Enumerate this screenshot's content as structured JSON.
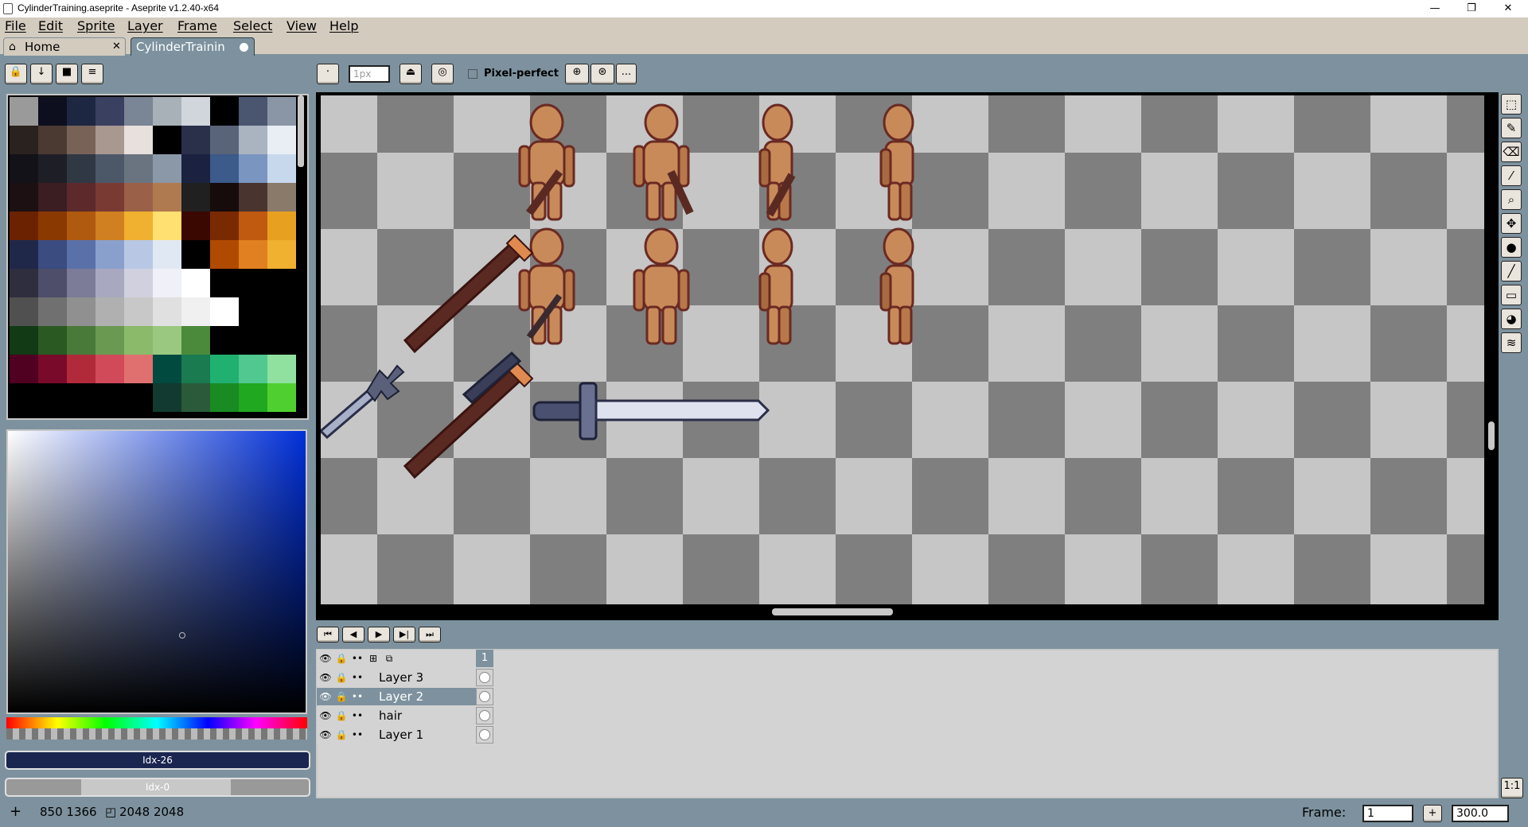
{
  "window": {
    "title": "CylinderTraining.aseprite - Aseprite v1.2.40-x64",
    "min_glyph": "—",
    "restore_glyph": "❐",
    "close_glyph": "✕"
  },
  "menubar": [
    "File",
    "Edit",
    "Sprite",
    "Layer",
    "Frame",
    "Select",
    "View",
    "Help"
  ],
  "tabs": [
    {
      "label": "Home",
      "icon": "home-icon",
      "close_glyph": "✕"
    },
    {
      "label": "CylinderTrainin",
      "active": true
    }
  ],
  "context_bar": {
    "brush_size_placeholder": "1px",
    "pixel_perfect_label": "Pixel-perfect",
    "more_label": "..."
  },
  "palette": {
    "swatches": [
      "#9a9a9a",
      "#0d0f1f",
      "#1d2742",
      "#3a4060",
      "#7a8595",
      "#a8b0b8",
      "#d0d6dc",
      "#000000",
      "#4a5570",
      "#8a96a6",
      "#2a221e",
      "#4a3a32",
      "#786258",
      "#a89890",
      "#e8e0dc",
      "#000000",
      "#2a2f4a",
      "#5a6478",
      "#aab4c0",
      "#e8eef4",
      "#121218",
      "#1e1e26",
      "#303844",
      "#4c5868",
      "#6a7480",
      "#8a98a8",
      "#1a2240",
      "#3c5a8a",
      "#7a96c0",
      "#c8d8ec",
      "#1c1012",
      "#3a1e22",
      "#5c2a2a",
      "#7a3a34",
      "#9a6048",
      "#b07a50",
      "#202020",
      "#160c0c",
      "#4a3430",
      "#8a7a6a",
      "#6a2200",
      "#8a3a00",
      "#b05a10",
      "#d08020",
      "#f0b030",
      "#ffe070",
      "#3a0800",
      "#7a2a00",
      "#c05a10",
      "#e8a020",
      "#20284a",
      "#3a4c80",
      "#5a70a8",
      "#8aa0cc",
      "#b8c8e4",
      "#e0e8f4",
      "#000000",
      "#b04a00",
      "#e08020",
      "#f0b030",
      "#2e2e3e",
      "#4e4e6a",
      "#7c7c98",
      "#a8a8c0",
      "#d0d0de",
      "#f0f0f8",
      "#ffffff",
      "#000000",
      "#000000",
      "#000000",
      "#505050",
      "#707070",
      "#909090",
      "#b0b0b0",
      "#c8c8c8",
      "#e0e0e0",
      "#f0f0f0",
      "#ffffff",
      "#000000",
      "#000000",
      "#123a14",
      "#2a5a22",
      "#4a7a3a",
      "#6a9a52",
      "#8aba6a",
      "#9ac880",
      "#4a8a3a",
      "#000000",
      "#000000",
      "#000000",
      "#500020",
      "#7a0a2a",
      "#b02a3a",
      "#d04a5a",
      "#e07070",
      "#004a40",
      "#1a7a50",
      "#20b070",
      "#50c890",
      "#90e0a0",
      "#000000",
      "#000000",
      "#000000",
      "#000000",
      "#000000",
      "#123a2e",
      "#2a5a3a",
      "#1a8a22",
      "#20a820",
      "#50d030"
    ]
  },
  "color_slots": {
    "foreground_label": "Idx-26",
    "background_label": "Idx-0"
  },
  "tools": [
    {
      "name": "marquee-tool",
      "glyph": "⬚"
    },
    {
      "name": "pencil-tool",
      "glyph": "✎"
    },
    {
      "name": "eraser-tool",
      "glyph": "⌫"
    },
    {
      "name": "eyedropper-tool",
      "glyph": "⁄"
    },
    {
      "name": "zoom-tool",
      "glyph": "⌕"
    },
    {
      "name": "move-tool",
      "glyph": "✥"
    },
    {
      "name": "fill-tool",
      "glyph": "●"
    },
    {
      "name": "line-tool",
      "glyph": "╱"
    },
    {
      "name": "rectangle-tool",
      "glyph": "▭"
    },
    {
      "name": "contour-tool",
      "glyph": "◕"
    },
    {
      "name": "blur-tool",
      "glyph": "≋"
    }
  ],
  "zoom_reset_label": "1:1",
  "timeline": {
    "controls": [
      "⏮",
      "◀",
      "▶",
      "▶|",
      "⏭"
    ],
    "frame_number": "1",
    "layers": [
      {
        "name": "Layer 3",
        "selected": false
      },
      {
        "name": "Layer 2",
        "selected": true
      },
      {
        "name": "hair",
        "selected": false
      },
      {
        "name": "Layer 1",
        "selected": false
      }
    ]
  },
  "status": {
    "cursor_glyph": "+",
    "coords": "850 1366",
    "size_glyph": "◰",
    "size": "2048 2048",
    "frame_label": "Frame:",
    "frame_value": "1",
    "add_frame_glyph": "+",
    "zoom_value": "300.0"
  }
}
